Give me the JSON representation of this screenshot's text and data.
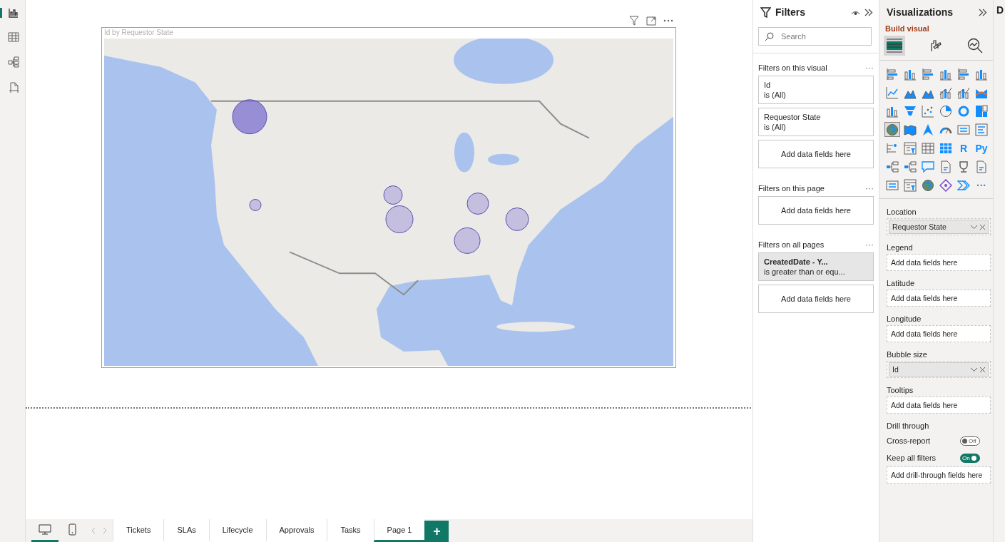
{
  "left_rail": [
    {
      "kind": "report",
      "selected": true
    },
    {
      "kind": "table",
      "selected": false
    },
    {
      "kind": "model",
      "selected": false
    },
    {
      "kind": "dax",
      "selected": false
    }
  ],
  "visual": {
    "title": "Id by Requestor State"
  },
  "filters": {
    "title": "Filters",
    "search": {
      "placeholder": "Search"
    },
    "sections": [
      {
        "heading": "Filters on this visual",
        "menu": "···",
        "cards": [
          {
            "kind": "filter",
            "field": "Id",
            "condition": "is (All)",
            "applied": false
          },
          {
            "kind": "filter",
            "field": "Requestor State",
            "condition": "is (All)",
            "applied": false
          },
          {
            "kind": "drop",
            "label": "Add data fields here"
          }
        ]
      },
      {
        "heading": "Filters on this page",
        "menu": "···",
        "cards": [
          {
            "kind": "drop",
            "label": "Add data fields here"
          }
        ]
      },
      {
        "heading": "Filters on all pages",
        "menu": "···",
        "cards": [
          {
            "kind": "filter",
            "field": "CreatedDate - Y...",
            "condition": "is greater than or equ...",
            "applied": true
          },
          {
            "kind": "drop",
            "label": "Add data fields here"
          }
        ]
      }
    ]
  },
  "visualizations": {
    "title": "Visualizations",
    "subtitle": "Build visual",
    "modes": [
      {
        "kind": "build",
        "selected": true
      },
      {
        "kind": "format",
        "selected": false
      },
      {
        "kind": "analytics",
        "selected": false
      }
    ],
    "types": [
      {
        "kind": "hbar",
        "selected": false
      },
      {
        "kind": "column",
        "selected": false
      },
      {
        "kind": "hbar",
        "selected": false
      },
      {
        "kind": "column",
        "selected": false
      },
      {
        "kind": "hbar",
        "selected": false
      },
      {
        "kind": "column",
        "selected": false
      },
      {
        "kind": "line",
        "selected": false
      },
      {
        "kind": "area",
        "selected": false
      },
      {
        "kind": "area",
        "selected": false
      },
      {
        "kind": "combo",
        "selected": false
      },
      {
        "kind": "combo",
        "selected": false
      },
      {
        "kind": "ribbon",
        "selected": false
      },
      {
        "kind": "column",
        "selected": false
      },
      {
        "kind": "funnel",
        "selected": false
      },
      {
        "kind": "scatter",
        "selected": false
      },
      {
        "kind": "pie",
        "selected": false
      },
      {
        "kind": "donut",
        "selected": false
      },
      {
        "kind": "treemap",
        "selected": false
      },
      {
        "kind": "globe",
        "selected": true
      },
      {
        "kind": "filledmap",
        "selected": false
      },
      {
        "kind": "arrow",
        "selected": false
      },
      {
        "kind": "gauge",
        "selected": false
      },
      {
        "kind": "card",
        "selected": false
      },
      {
        "kind": "list",
        "selected": false
      },
      {
        "kind": "kpi",
        "selected": false
      },
      {
        "kind": "slicer",
        "selected": false
      },
      {
        "kind": "table",
        "selected": false
      },
      {
        "kind": "matrix",
        "selected": false
      },
      {
        "kind": "text",
        "text": "R",
        "selected": false
      },
      {
        "kind": "text",
        "text": "Py",
        "selected": false
      },
      {
        "kind": "tree",
        "selected": false
      },
      {
        "kind": "tree",
        "selected": false
      },
      {
        "kind": "speech",
        "selected": false
      },
      {
        "kind": "document",
        "selected": false
      },
      {
        "kind": "trophy",
        "selected": false
      },
      {
        "kind": "document",
        "selected": false
      },
      {
        "kind": "card",
        "selected": false
      },
      {
        "kind": "slicer",
        "selected": false
      },
      {
        "kind": "globe",
        "selected": false
      },
      {
        "kind": "diamond",
        "selected": false
      },
      {
        "kind": "chevron",
        "selected": false
      },
      {
        "kind": "text",
        "text": "···",
        "selected": false
      }
    ],
    "wells": [
      {
        "label": "Location",
        "field": "Requestor State"
      },
      {
        "label": "Legend",
        "drop": "Add data fields here"
      },
      {
        "label": "Latitude",
        "drop": "Add data fields here"
      },
      {
        "label": "Longitude",
        "drop": "Add data fields here"
      },
      {
        "label": "Bubble size",
        "field": "Id"
      },
      {
        "label": "Tooltips",
        "drop": "Add data fields here"
      }
    ],
    "drill_through": {
      "heading": "Drill through",
      "toggles": [
        {
          "label": "Cross-report",
          "on": false,
          "state_label": "Off"
        },
        {
          "label": "Keep all filters",
          "on": true,
          "state_label": "On"
        }
      ],
      "drop": "Add drill-through fields here"
    }
  },
  "data_pane": {
    "title": "D"
  },
  "pages": {
    "views": [
      {
        "kind": "desktop",
        "selected": true
      },
      {
        "kind": "mobile",
        "selected": false
      }
    ],
    "tabs": [
      {
        "label": "Tickets",
        "selected": false
      },
      {
        "label": "SLAs",
        "selected": false
      },
      {
        "label": "Lifecycle",
        "selected": false
      },
      {
        "label": "Approvals",
        "selected": false
      },
      {
        "label": "Tasks",
        "selected": false
      },
      {
        "label": "Page 1",
        "selected": true
      }
    ],
    "add_label": "+"
  }
}
